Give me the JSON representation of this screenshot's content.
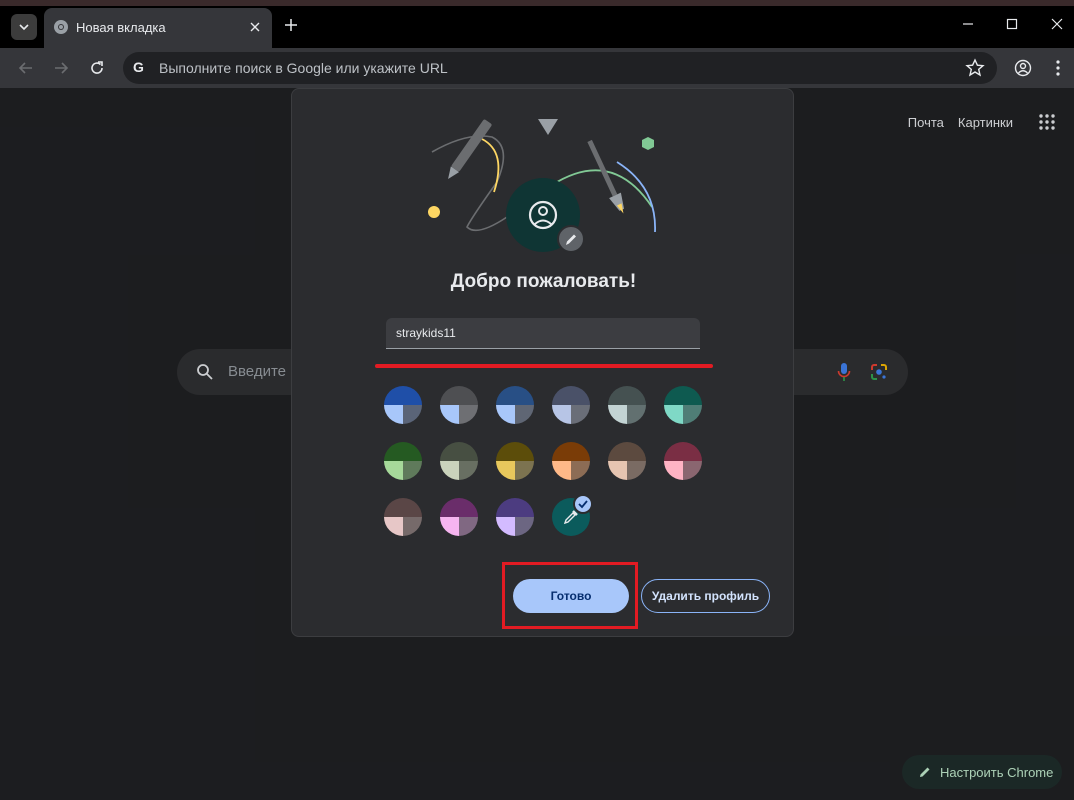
{
  "browser": {
    "tab_title": "Новая вкладка",
    "omnibox_placeholder": "Выполните поиск в Google или укажите URL"
  },
  "ntp": {
    "link_mail": "Почта",
    "link_images": "Картинки",
    "search_placeholder": "Введите",
    "customize_label": "Настроить Chrome"
  },
  "dialog": {
    "title": "Добро пожаловать!",
    "name_value": "straykids11",
    "done_label": "Готово",
    "delete_label": "Удалить профиль",
    "colors": [
      [
        "#1f4fa8",
        "#a8c7fa",
        "#5a6478"
      ],
      [
        "#4e4f52",
        "#a8c7fa",
        "#6e6f73"
      ],
      [
        "#284f85",
        "#a8c7fa",
        "#5f6674"
      ],
      [
        "#4a5168",
        "#b7c5e6",
        "#6a6e78"
      ],
      [
        "#455151",
        "#c3d4d4",
        "#627070"
      ],
      [
        "#0e5a50",
        "#7fd9c6",
        "#4f7d76"
      ],
      [
        "#255a22",
        "#a6d99a",
        "#5f7a5b"
      ],
      [
        "#474f42",
        "#cad3bc",
        "#686f62"
      ],
      [
        "#5c4d0a",
        "#e8c85c",
        "#7c7350"
      ],
      [
        "#7a3c07",
        "#ffb988",
        "#8c6c55"
      ],
      [
        "#5c4a3f",
        "#e6c5b1",
        "#7a6b63"
      ],
      [
        "#7a2e44",
        "#ffb3c4",
        "#8a6670"
      ],
      [
        "#5a4646",
        "#e7c7c7",
        "#766a6a"
      ],
      [
        "#6a2d6a",
        "#f6b5f0",
        "#806882"
      ],
      [
        "#4c3c80",
        "#d3bbff",
        "#6c6682"
      ]
    ],
    "selected_color": "#0b5b5c"
  }
}
